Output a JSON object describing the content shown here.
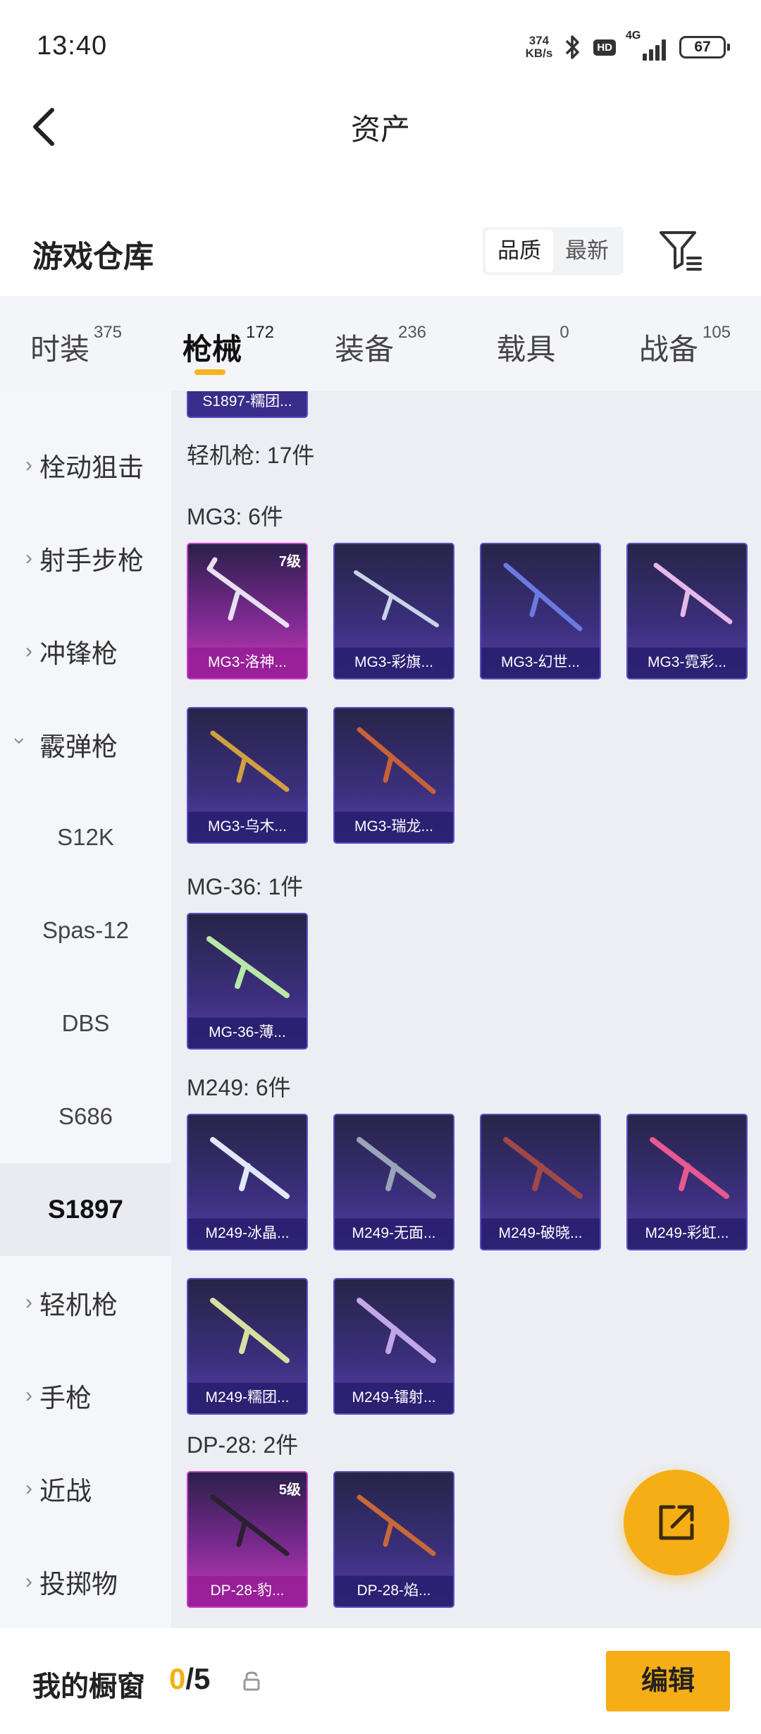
{
  "status_bar": {
    "time": "13:40",
    "net_speed_value": "374",
    "net_speed_unit": "KB/s",
    "hd": "HD",
    "network": "4G",
    "battery": "67"
  },
  "header": {
    "title": "资产"
  },
  "section": {
    "title": "游戏仓库",
    "sort_options": [
      "品质",
      "最新"
    ],
    "sort_selected": "品质"
  },
  "tabs": [
    {
      "label": "时装",
      "count": "375"
    },
    {
      "label": "枪械",
      "count": "172"
    },
    {
      "label": "装备",
      "count": "236"
    },
    {
      "label": "载具",
      "count": "0"
    },
    {
      "label": "战备",
      "count": "105"
    }
  ],
  "active_tab": "枪械",
  "sidebar": [
    {
      "label": "栓动狙击",
      "type": "category",
      "expanded": false
    },
    {
      "label": "射手步枪",
      "type": "category",
      "expanded": false
    },
    {
      "label": "冲锋枪",
      "type": "category",
      "expanded": false
    },
    {
      "label": "霰弹枪",
      "type": "category",
      "expanded": true
    },
    {
      "label": "S12K",
      "type": "sub"
    },
    {
      "label": "Spas-12",
      "type": "sub"
    },
    {
      "label": "DBS",
      "type": "sub"
    },
    {
      "label": "S686",
      "type": "sub"
    },
    {
      "label": "S1897",
      "type": "sub",
      "selected": true
    },
    {
      "label": "轻机枪",
      "type": "category",
      "expanded": false
    },
    {
      "label": "手枪",
      "type": "category",
      "expanded": false
    },
    {
      "label": "近战",
      "type": "category",
      "expanded": false
    },
    {
      "label": "投掷物",
      "type": "category",
      "expanded": false
    }
  ],
  "content": {
    "partial_top_item": "S1897-糯团...",
    "category_header": "轻机枪: 17件",
    "groups": [
      {
        "label": "MG3: 6件",
        "items": [
          {
            "name": "MG3-洛神...",
            "level": "7级",
            "rarity": "pink"
          },
          {
            "name": "MG3-彩旗...",
            "rarity": "purple"
          },
          {
            "name": "MG3-幻世...",
            "rarity": "purple"
          },
          {
            "name": "MG3-霓彩...",
            "rarity": "purple"
          },
          {
            "name": "MG3-乌木...",
            "rarity": "purple"
          },
          {
            "name": "MG3-瑞龙...",
            "rarity": "purple"
          }
        ]
      },
      {
        "label": "MG-36: 1件",
        "items": [
          {
            "name": "MG-36-薄...",
            "rarity": "purple"
          }
        ]
      },
      {
        "label": "M249: 6件",
        "items": [
          {
            "name": "M249-冰晶...",
            "rarity": "purple"
          },
          {
            "name": "M249-无面...",
            "rarity": "purple"
          },
          {
            "name": "M249-破晓...",
            "rarity": "purple"
          },
          {
            "name": "M249-彩虹...",
            "rarity": "purple"
          },
          {
            "name": "M249-糯团...",
            "rarity": "purple"
          },
          {
            "name": "M249-镭射...",
            "rarity": "purple"
          }
        ]
      },
      {
        "label": "DP-28: 2件",
        "items": [
          {
            "name": "DP-28-豹...",
            "level": "5级",
            "rarity": "pink"
          },
          {
            "name": "DP-28-焰...",
            "rarity": "purple"
          }
        ]
      }
    ]
  },
  "bottom": {
    "shelf_label": "我的橱窗",
    "shelf_used": "0",
    "shelf_total": "/5",
    "edit_label": "编辑"
  },
  "colors": {
    "accent": "#f6ae16",
    "card_purple": "#3b2f7c",
    "card_pink": "#c83ab8",
    "sidebar_bg": "#f5f6fa",
    "content_bg": "#eceef4"
  },
  "icons": [
    "back-arrow-icon",
    "bluetooth-icon",
    "filter-icon",
    "share-icon",
    "lock-icon",
    "chevron-right-icon",
    "chevron-down-icon"
  ]
}
